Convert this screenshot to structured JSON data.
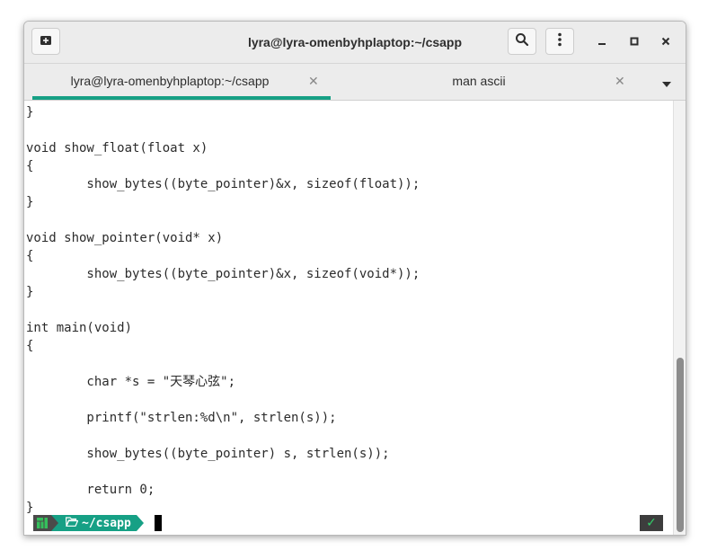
{
  "window": {
    "title": "lyra@lyra-omenbyhplaptop:~/csapp"
  },
  "titlebar_icons": {
    "new_tab": "new-tab-icon",
    "search": "search-icon",
    "menu": "kebab-menu-icon",
    "minimize": "minimize-icon",
    "maximize": "maximize-icon",
    "close": "close-icon"
  },
  "controls": {
    "minimize": "–",
    "maximize": "◻",
    "close": "✕"
  },
  "tabs": [
    {
      "label": "lyra@lyra-omenbyhplaptop:~/csapp",
      "active": true,
      "close": "✕"
    },
    {
      "label": "man ascii",
      "active": false,
      "close": "✕"
    }
  ],
  "terminal": {
    "lines": [
      "}",
      "",
      "void show_float(float x)",
      "{",
      "        show_bytes((byte_pointer)&x, sizeof(float));",
      "}",
      "",
      "void show_pointer(void* x)",
      "{",
      "        show_bytes((byte_pointer)&x, sizeof(void*));",
      "}",
      "",
      "int main(void)",
      "{",
      "",
      "        char *s = \"天琴心弦\";",
      "",
      "        printf(\"strlen:%d\\n\", strlen(s));",
      "",
      "        show_bytes((byte_pointer) s, strlen(s));",
      "",
      "        return 0;",
      "}"
    ]
  },
  "prompt": {
    "directory": "~/csapp",
    "status_symbol": "✓"
  },
  "colors": {
    "accent": "#16a085",
    "text": "#2b2b2b",
    "titlebar": "#ececec"
  }
}
